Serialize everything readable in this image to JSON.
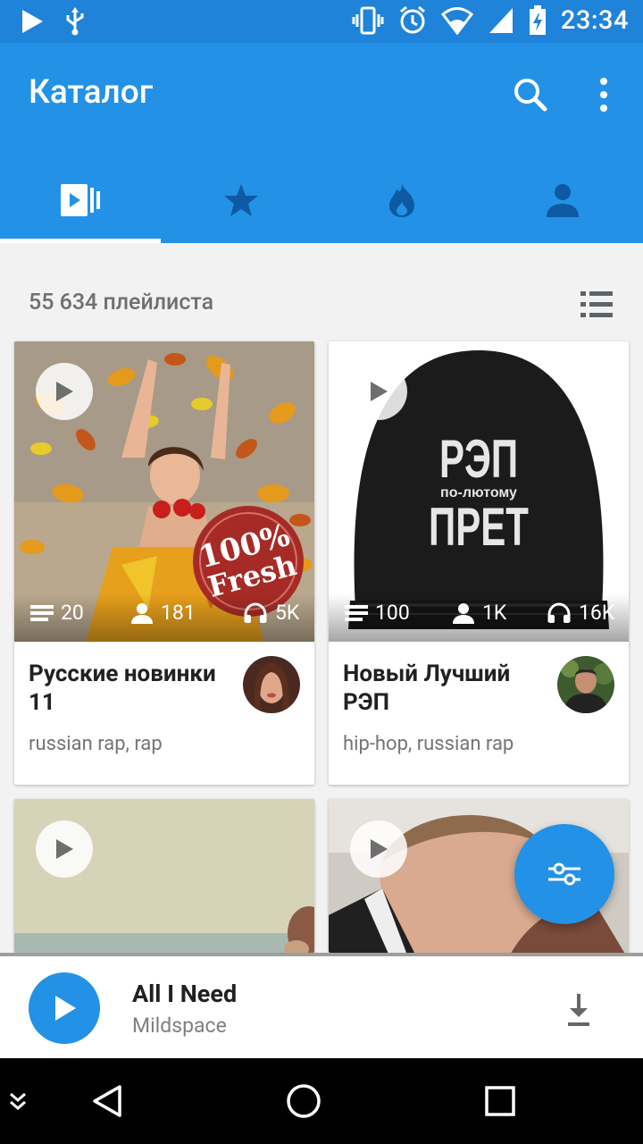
{
  "status_bar": {
    "time": "23:34",
    "icons_left": [
      "play-icon",
      "usb-icon"
    ],
    "icons_right": [
      "vibrate-icon",
      "alarm-icon",
      "wifi-icon",
      "signal-icon",
      "battery-charging-icon"
    ]
  },
  "toolbar": {
    "title": "Каталог",
    "actions": [
      "search-icon",
      "more-vert-icon"
    ],
    "tabs": [
      {
        "icon": "playlist-video-icon",
        "selected": true
      },
      {
        "icon": "star-icon",
        "selected": false
      },
      {
        "icon": "fire-icon",
        "selected": false
      },
      {
        "icon": "person-icon",
        "selected": false
      }
    ]
  },
  "content": {
    "count_label": "55 634 плейлиста",
    "cards": [
      {
        "title": "Русские новинки 11",
        "tags": "russian rap, rap",
        "tracks": "20",
        "followers": "181",
        "listens": "5K"
      },
      {
        "title": "Новый Лучший РЭП",
        "tags": "hip-hop, russian rap",
        "tracks": "100",
        "followers": "1K",
        "listens": "16K",
        "cover_text": [
          "РЭП",
          "по-лютому",
          "ПРЕТ"
        ]
      }
    ]
  },
  "player": {
    "track_title": "All I Need",
    "artist": "Mildspace"
  },
  "colors": {
    "primary": "#2392e6",
    "status_bar": "#1e83d9",
    "background": "#f2f2f2"
  }
}
